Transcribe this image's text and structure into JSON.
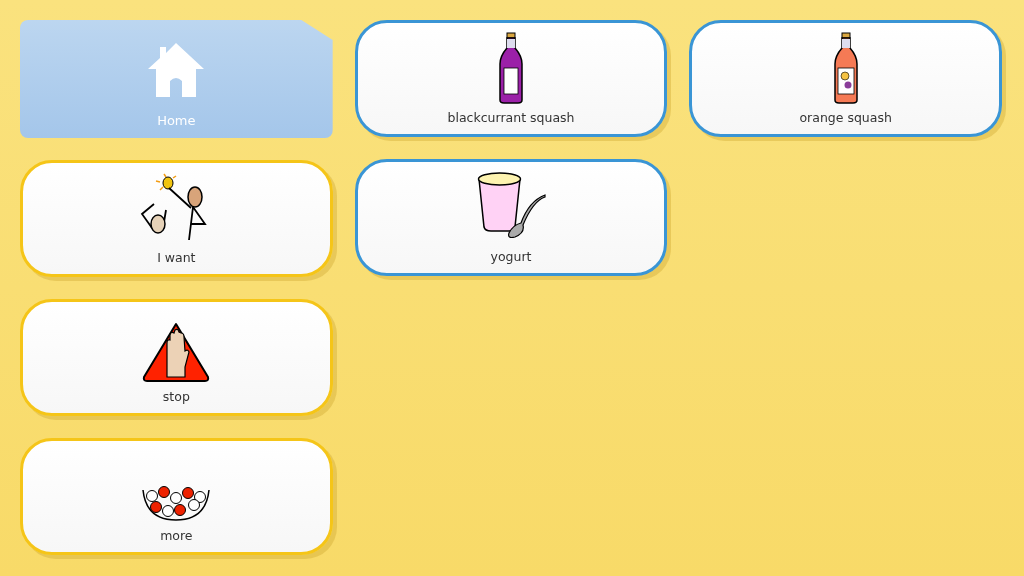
{
  "columns": [
    {
      "cells": [
        {
          "kind": "home",
          "label": "Home"
        },
        {
          "kind": "i-want",
          "label": "I want",
          "color": "#f5c518"
        },
        {
          "kind": "stop",
          "label": "stop",
          "color": "#f5c518"
        },
        {
          "kind": "more",
          "label": "more",
          "color": "#f5c518"
        }
      ]
    },
    {
      "cells": [
        {
          "kind": "blackcurrant-bottle",
          "label": "blackcurrant squash",
          "color": "#3a95d5"
        },
        {
          "kind": "yogurt",
          "label": "yogurt",
          "color": "#3a95d5"
        }
      ]
    },
    {
      "cells": [
        {
          "kind": "orange-bottle",
          "label": "orange squash",
          "color": "#3a95d5"
        }
      ]
    }
  ]
}
